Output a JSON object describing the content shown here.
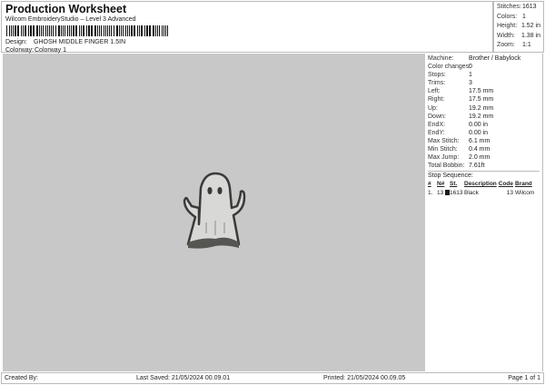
{
  "header": {
    "title": "Production Worksheet",
    "subtitle": "Wilcom EmbroideryStudio – Level 3 Advanced",
    "design_label": "Design:",
    "design": "GHOSH MIDDLE FINGER 1.5IN",
    "colorway_label": "Colorway:",
    "colorway": "Colorway 1"
  },
  "stats": [
    {
      "label": "Stitches:",
      "value": "1613"
    },
    {
      "label": "Colors:",
      "value": "1"
    },
    {
      "label": "Height:",
      "value": "1.52 in"
    },
    {
      "label": "Width:",
      "value": "1.38 in"
    },
    {
      "label": "Zoom:",
      "value": "1:1"
    }
  ],
  "details": [
    {
      "label": "Machine:",
      "value": "Brother / Babylock"
    },
    {
      "label": "Color changes:",
      "value": "0"
    },
    {
      "label": "Stops:",
      "value": "1"
    },
    {
      "label": "Trims:",
      "value": "3"
    },
    {
      "label": "Left:",
      "value": "17.5 mm"
    },
    {
      "label": "Right:",
      "value": "17.5 mm"
    },
    {
      "label": "Up:",
      "value": "19.2 mm"
    },
    {
      "label": "Down:",
      "value": "19.2 mm"
    },
    {
      "label": "EndX:",
      "value": "0.00 in"
    },
    {
      "label": "EndY:",
      "value": "0.00 in"
    },
    {
      "label": "Max Stitch:",
      "value": "6.1 mm"
    },
    {
      "label": "Min Stitch:",
      "value": "0.4 mm"
    },
    {
      "label": "Max Jump:",
      "value": "2.0 mm"
    },
    {
      "label": "Total Bobbin:",
      "value": "7.61ft"
    }
  ],
  "stop_sequence": {
    "title": "Stop Sequence:",
    "columns": [
      "#",
      "N#",
      "St.",
      "Description",
      "Code",
      "Brand"
    ],
    "rows": [
      {
        "num": "1.",
        "n": "13",
        "color": "#1a1a1a",
        "st": "1613",
        "desc": "Black",
        "code": "13",
        "brand": "Wilcom"
      }
    ]
  },
  "footer": {
    "created_by": "Created By:",
    "last_saved": "Last Saved: 21/05/2024 00.09.01",
    "printed": "Printed: 21/05/2024 00.09.05",
    "page": "Page 1 of 1"
  }
}
